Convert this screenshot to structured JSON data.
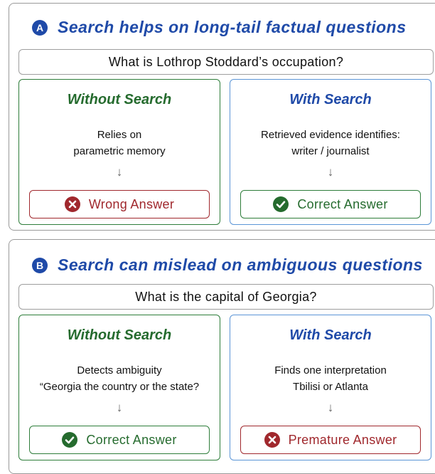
{
  "panels": [
    {
      "badge": "A",
      "heading": "Search helps on long-tail factual questions",
      "question": "What is Lothrop Stoddard’s occupation?",
      "without": {
        "title": "Without Search",
        "line1": "Relies on",
        "line2": "parametric memory",
        "arrow": "↓",
        "result": "Wrong Answer",
        "result_icon": "x-circle-icon",
        "result_color": "#a0282d"
      },
      "with": {
        "title": "With Search",
        "line1": "Retrieved evidence identifies:",
        "line2": "writer / journalist",
        "arrow": "↓",
        "result": "Correct Answer",
        "result_icon": "check-circle-icon",
        "result_color": "#256b2e"
      }
    },
    {
      "badge": "B",
      "heading": "Search can mislead on ambiguous questions",
      "question": "What is the capital of Georgia?",
      "without": {
        "title": "Without Search",
        "line1": "Detects ambiguity",
        "line2": "“Georgia the country or the state?",
        "arrow": "↓",
        "result": "Correct Answer",
        "result_icon": "check-circle-icon",
        "result_color": "#256b2e"
      },
      "with": {
        "title": "With Search",
        "line1": "Finds one interpretation",
        "line2": "Tbilisi or Atlanta",
        "arrow": "↓",
        "result": "Premature Answer",
        "result_icon": "x-circle-icon",
        "result_color": "#a0282d"
      }
    }
  ]
}
